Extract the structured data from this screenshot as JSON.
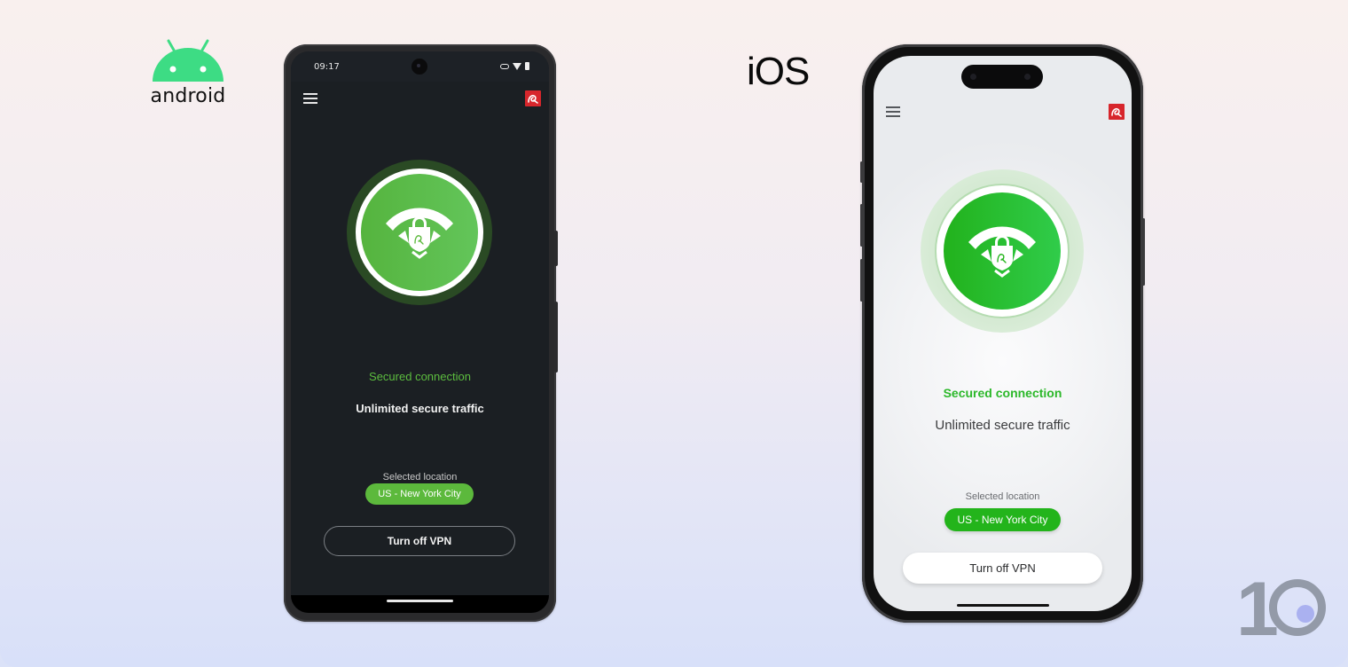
{
  "platforms": {
    "android_label": "android",
    "ios_label": "iOS"
  },
  "android": {
    "status_bar": {
      "time": "09:17",
      "icons": [
        "vpn-key-icon",
        "wifi-icon",
        "battery-icon"
      ]
    },
    "header": {
      "menu_icon": "hamburger-menu-icon",
      "brand_icon": "avira-logo-icon"
    },
    "vpn_status_icon": "wifi-lock-shield-icon",
    "status_text": "Secured connection",
    "traffic_text": "Unlimited secure traffic",
    "location_label": "Selected location",
    "location_value": "US - New York City",
    "turn_off_label": "Turn off VPN"
  },
  "ios": {
    "header": {
      "menu_icon": "hamburger-menu-icon",
      "brand_icon": "avira-logo-icon"
    },
    "vpn_status_icon": "wifi-lock-shield-icon",
    "status_text": "Secured connection",
    "traffic_text": "Unlimited secure traffic",
    "location_label": "Selected location",
    "location_value": "US - New York City",
    "turn_off_label": "Turn off VPN"
  },
  "watermark": {
    "text": "10"
  },
  "colors": {
    "android_green": "#5cb93c",
    "ios_green": "#23b41b",
    "avira_red": "#d7262c",
    "android_bg": "#1b1f23"
  }
}
